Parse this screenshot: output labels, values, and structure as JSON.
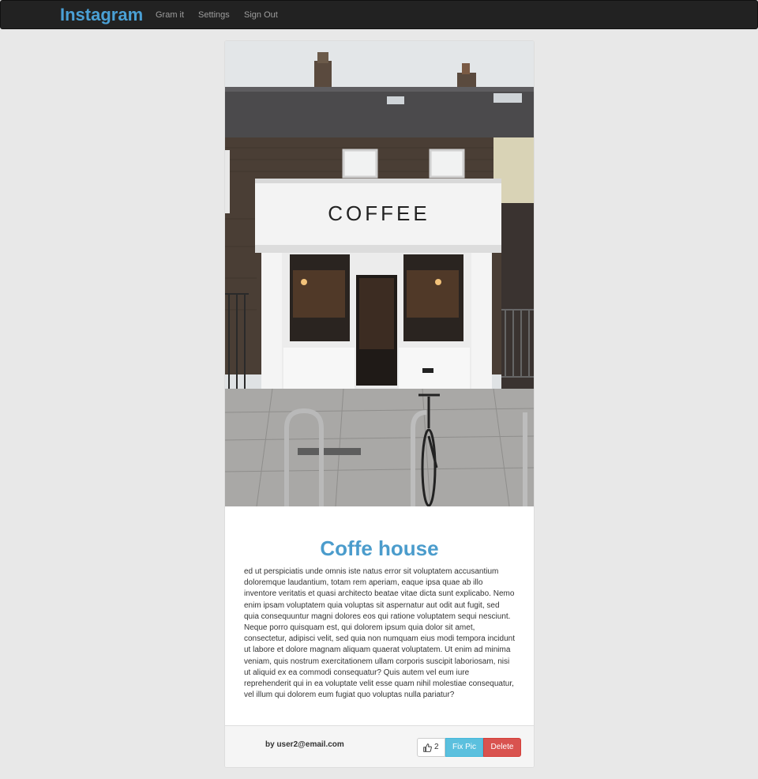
{
  "navbar": {
    "brand": "Instagram",
    "links": [
      "Gram it",
      "Settings",
      "Sign Out"
    ]
  },
  "post": {
    "image": {
      "description_icon": "coffee-shop-photo",
      "sign_text": "COFFEE"
    },
    "title": "Coffe house",
    "body": "ed ut perspiciatis unde omnis iste natus error sit voluptatem accusantium doloremque laudantium, totam rem aperiam, eaque ipsa quae ab illo inventore veritatis et quasi architecto beatae vitae dicta sunt explicabo. Nemo enim ipsam voluptatem quia voluptas sit aspernatur aut odit aut fugit, sed quia consequuntur magni dolores eos qui ratione voluptatem sequi nesciunt. Neque porro quisquam est, qui dolorem ipsum quia dolor sit amet, consectetur, adipisci velit, sed quia non numquam eius modi tempora incidunt ut labore et dolore magnam aliquam quaerat voluptatem. Ut enim ad minima veniam, quis nostrum exercitationem ullam corporis suscipit laboriosam, nisi ut aliquid ex ea commodi consequatur? Quis autem vel eum iure reprehenderit qui in ea voluptate velit esse quam nihil molestiae consequatur, vel illum qui dolorem eum fugiat quo voluptas nulla pariatur?",
    "author": "by user2@email.com",
    "likes": "2",
    "fix_label": "Fix Pic",
    "delete_label": "Delete"
  },
  "colors": {
    "brand": "#4aa0d5",
    "title": "#4b9ccc",
    "info_button": "#5bc0de",
    "danger_button": "#d9534f",
    "navbar_bg": "#222222",
    "page_bg": "#e8e8e8"
  }
}
